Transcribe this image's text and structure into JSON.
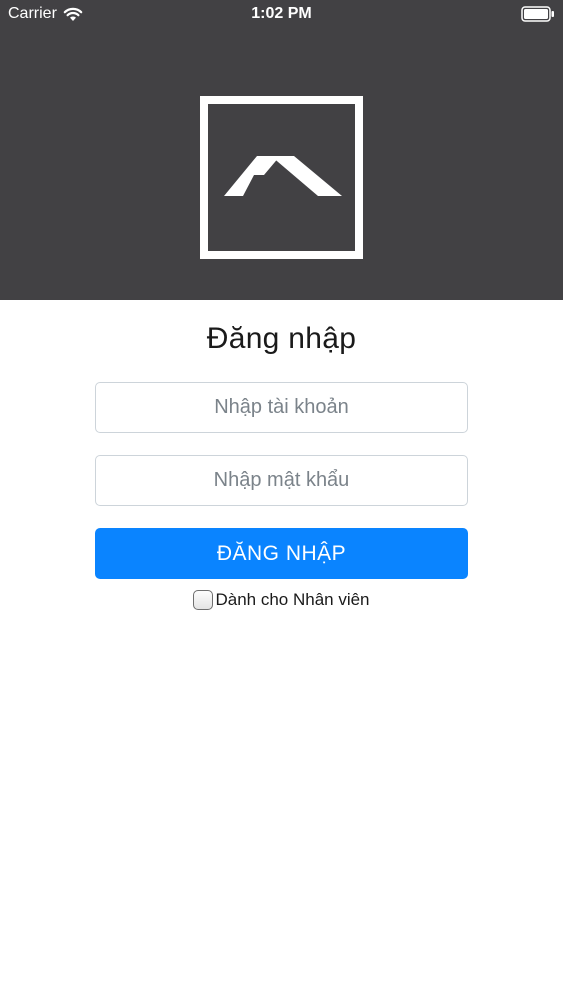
{
  "status_bar": {
    "carrier": "Carrier",
    "time": "1:02 PM"
  },
  "header": {
    "background_color": "#424144",
    "logo_icon": "roof-logo-icon"
  },
  "login": {
    "title": "Đăng nhập",
    "username_placeholder": "Nhập tài khoản",
    "password_placeholder": "Nhập mật khẩu",
    "submit_label": "ĐĂNG NHẬP",
    "staff_checkbox_label": "Dành cho Nhân viên",
    "staff_checked": false
  },
  "colors": {
    "primary": "#0a84ff",
    "header": "#424144",
    "input_border": "#cdd4da"
  }
}
